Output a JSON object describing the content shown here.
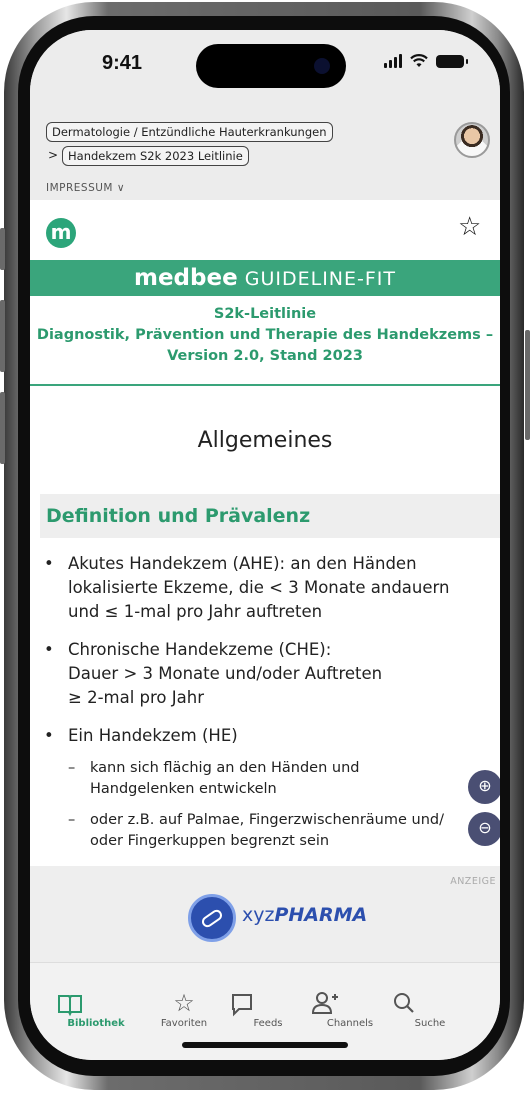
{
  "status": {
    "time": "9:41"
  },
  "breadcrumb": {
    "category": "Dermatologie / Entzündliche Hauterkrankungen",
    "separator": ">",
    "current": "Handekzem S2k 2023 Leitlinie"
  },
  "impressum": {
    "label": "IMPRESSUM",
    "chevron": "∨"
  },
  "header": {
    "logo_letter": "m",
    "favorite_icon": "☆"
  },
  "brand": {
    "name": "medbee",
    "tagline": "GUIDELINE-FIT"
  },
  "guideline": {
    "line1": "S2k-Leitlinie",
    "line2": "Diagnostik, Prävention und Therapie des Handekzems –",
    "line3": "Version 2.0, Stand 2023"
  },
  "section": {
    "title": "Allgemeines",
    "subheading": "Definition und Prävalenz"
  },
  "content": {
    "bullet_symbol": "•",
    "dash_symbol": "–",
    "b1": [
      "Akutes Handekzem (AHE): an den Händen",
      "lokalisierte Ekzeme, die < 3 Monate andauern",
      "und ≤ 1-mal pro Jahr auftreten"
    ],
    "b2": [
      "Chronische Handekzeme (CHE):",
      "Dauer > 3 Monate und/oder Auftreten",
      "≥ 2-mal pro Jahr"
    ],
    "b3": [
      "Ein Handekzem (HE)"
    ],
    "sub1": [
      "kann sich flächig an den Händen und",
      "Handgelenken entwickeln"
    ],
    "sub2": [
      "oder z.B. auf Palmae, Fingerzwischenräume und/",
      "oder Fingerkuppen begrenzt sein"
    ]
  },
  "zoom": {
    "in": "⊕",
    "out": "⊖"
  },
  "ad": {
    "label": "ANZEIGE",
    "brand_prefix": "xyz",
    "brand_name": "PHARMA"
  },
  "tabs": [
    {
      "label": "Bibliothek",
      "icon": "book-icon",
      "glyph": "📖",
      "active": true
    },
    {
      "label": "Favoriten",
      "icon": "star-icon",
      "glyph": "☆",
      "active": false
    },
    {
      "label": "Feeds",
      "icon": "chat-icon",
      "glyph": "▭",
      "active": false
    },
    {
      "label": "Channels",
      "icon": "add-user-icon",
      "glyph": "⍝",
      "active": false
    },
    {
      "label": "Suche",
      "icon": "search-icon",
      "glyph": "⚲",
      "active": false
    }
  ]
}
